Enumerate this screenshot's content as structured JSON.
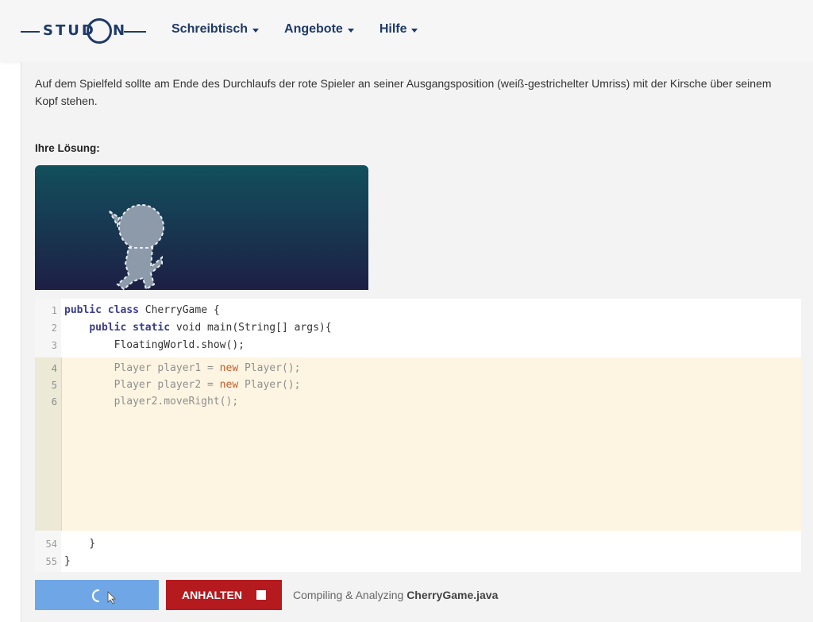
{
  "header": {
    "logo_left": "STUD",
    "logo_right": "N",
    "nav": [
      {
        "label": "Schreibtisch"
      },
      {
        "label": "Angebote"
      },
      {
        "label": "Hilfe"
      }
    ]
  },
  "content": {
    "description": "Auf dem Spielfeld sollte am Ende des Durchlaufs der rote Spieler an seiner Ausgangsposition (weiß-gestrichelter Umriss) mit der Kirsche über seinem Kopf stehen.",
    "solution_label": "Ihre Lösung:"
  },
  "editor": {
    "lines": [
      {
        "n": "1",
        "kw": "public class",
        "rest": " CherryGame {"
      },
      {
        "n": "2",
        "indent": "    ",
        "kw": "public static",
        "rest": " void main(String[] args){"
      },
      {
        "n": "3",
        "indent": "        ",
        "kw": "",
        "rest": "FloatingWorld.show();"
      }
    ],
    "edit_lines": [
      {
        "n": "4",
        "pre": "        Player player1 = ",
        "new": "new",
        "post": " Player();"
      },
      {
        "n": "5",
        "pre": "        Player player2 = ",
        "new": "new",
        "post": " Player();"
      },
      {
        "n": "6",
        "pre": "        player2.moveRight();",
        "new": "",
        "post": ""
      }
    ],
    "tail_lines": [
      {
        "n": "54",
        "code": "    }"
      },
      {
        "n": "55",
        "code": "}"
      }
    ]
  },
  "controls": {
    "stop_label": "ANHALTEN",
    "status_prefix": "Compiling & Analyzing ",
    "status_file": "CherryGame.java"
  },
  "colors": {
    "brand": "#1f3a68",
    "run_button": "#6fa7e6",
    "stop_button": "#b51a1f",
    "edit_zone": "#fdf5e2"
  }
}
